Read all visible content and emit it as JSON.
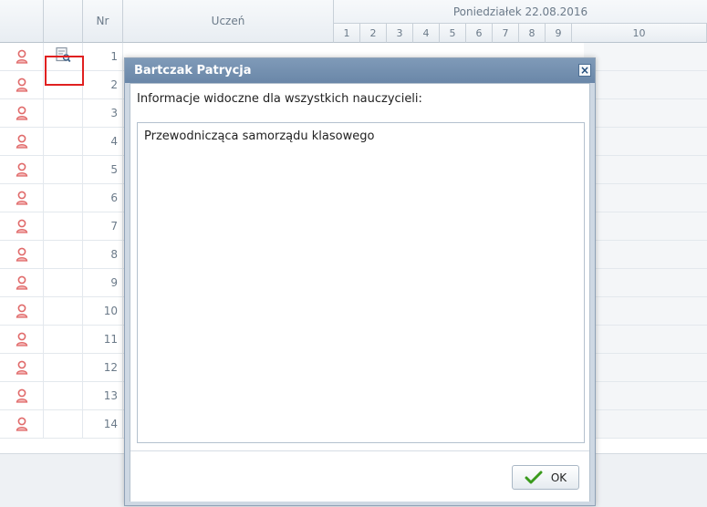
{
  "header": {
    "nr_label": "Nr",
    "student_label": "Uczeń",
    "day_label": "Poniedziałek 22.08.2016",
    "lessons": [
      "1",
      "2",
      "3",
      "4",
      "5",
      "6",
      "7",
      "8",
      "9",
      "10"
    ]
  },
  "rows": [
    "1",
    "2",
    "3",
    "4",
    "5",
    "6",
    "7",
    "8",
    "9",
    "10",
    "11",
    "12",
    "13",
    "14"
  ],
  "icons": {
    "student": "person-icon",
    "info": "note-magnifier-icon",
    "close": "close-icon",
    "ok": "checkmark-icon"
  },
  "colors": {
    "person": "#e06a6a",
    "title_bar": "#6f8cad",
    "check": "#3a9a1c",
    "highlight": "#e02020"
  },
  "dialog": {
    "title": "Bartczak Patrycja",
    "label": "Informacje widoczne dla wszystkich nauczycieli:",
    "text": "Przewodnicząca samorządu klasowego",
    "ok_label": "OK",
    "close_glyph": "×"
  }
}
